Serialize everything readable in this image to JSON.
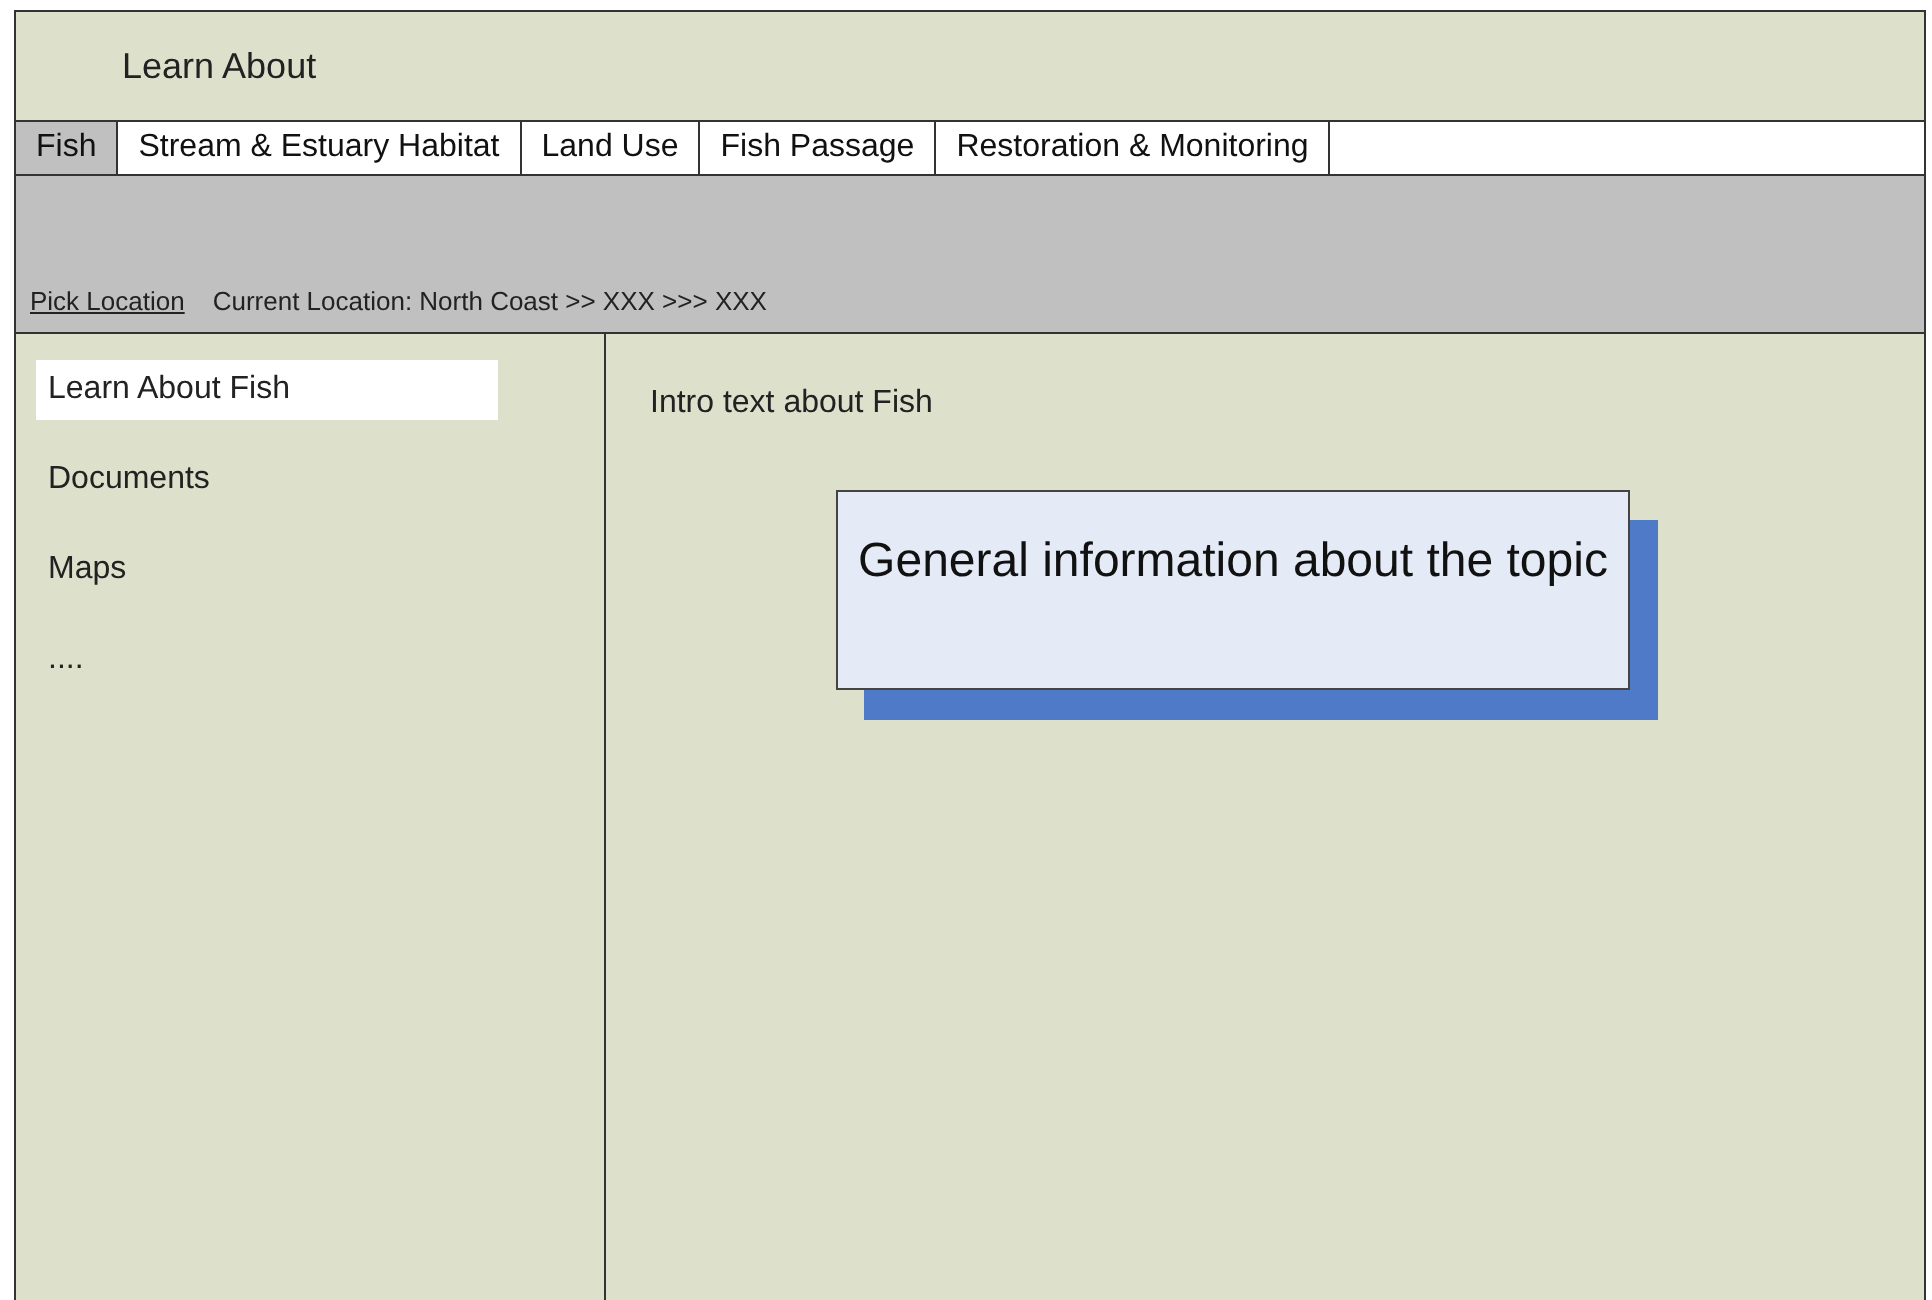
{
  "header": {
    "title": "Learn About"
  },
  "tabs": [
    {
      "label": "Fish",
      "selected": true
    },
    {
      "label": "Stream & Estuary Habitat",
      "selected": false
    },
    {
      "label": "Land Use",
      "selected": false
    },
    {
      "label": "Fish Passage",
      "selected": false
    },
    {
      "label": "Restoration & Monitoring",
      "selected": false
    }
  ],
  "location_bar": {
    "link": "Pick Location",
    "current": "Current Location: North Coast >> XXX >>> XXX"
  },
  "sidebar": {
    "items": [
      {
        "label": "Learn About Fish",
        "selected": true
      },
      {
        "label": "Documents",
        "selected": false
      },
      {
        "label": "Maps",
        "selected": false
      },
      {
        "label": "....",
        "selected": false
      }
    ]
  },
  "content": {
    "intro": "Intro text about Fish",
    "card": "General information about the topic"
  }
}
